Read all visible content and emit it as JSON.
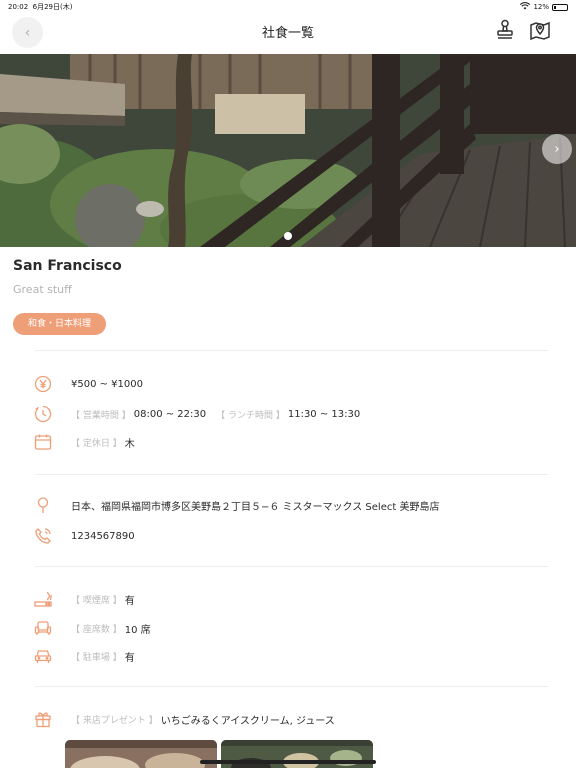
{
  "status_bar": {
    "time": "20:02",
    "date": "6月29日(木)",
    "battery": "12%"
  },
  "nav": {
    "back_glyph": "‹",
    "title": "社食一覧"
  },
  "hero": {
    "next_glyph": "›",
    "slide_count": 1,
    "current_slide": 1
  },
  "restaurant": {
    "name": "San Francisco",
    "description": "Great stuff",
    "category": "和食・日本料理"
  },
  "info": {
    "price": "¥500 ~ ¥1000",
    "hours_label": "【 営業時間 】",
    "hours": "08:00 ~ 22:30",
    "lunch_label": "【 ランチ時間 】",
    "lunch": "11:30 ~ 13:30",
    "holiday_label": "【 定休日 】",
    "holiday": "木"
  },
  "contact": {
    "address": "日本、福岡県福岡市博多区美野島２丁目５−６ ミスターマックス Select 美野島店",
    "phone": "1234567890"
  },
  "facilities": {
    "smoking_label": "【 喫煙席 】",
    "smoking": "有",
    "seats_label": "【 座席数 】",
    "seats": "10 席",
    "parking_label": "【 駐車場 】",
    "parking": "有"
  },
  "present": {
    "label": "【 来店プレゼント 】",
    "value": "いちごみるくアイスクリーム, ジュース"
  },
  "colors": {
    "accent": "#ee9f78",
    "label_gray": "#bcbcbc",
    "divider": "#eeeeee"
  },
  "icons": [
    "back-icon",
    "stamp-icon",
    "map-pin-icon",
    "yen-icon",
    "clock-icon",
    "calendar-icon",
    "location-icon",
    "phone-icon",
    "smoking-icon",
    "seat-icon",
    "parking-icon",
    "gift-icon"
  ]
}
